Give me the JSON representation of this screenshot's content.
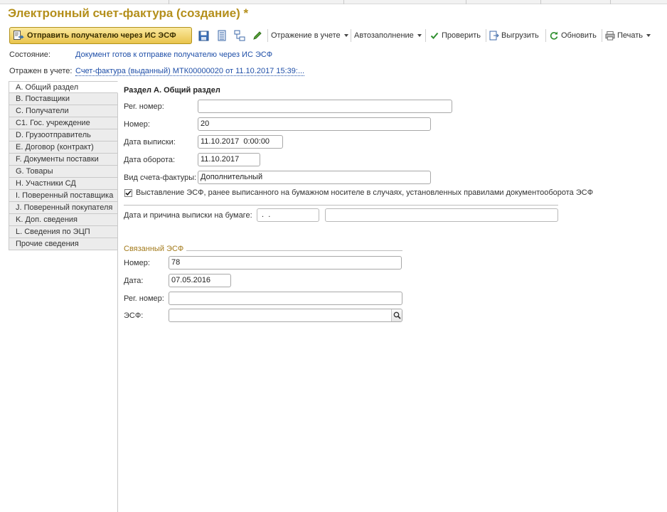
{
  "window": {
    "title": "Электронный счет-фактура (создание) *"
  },
  "toolbar": {
    "send_button": "Отправить получателю через ИС ЭСФ",
    "reflection": "Отражение в учете",
    "autofill": "Автозаполнение",
    "check": "Проверить",
    "export": "Выгрузить",
    "refresh": "Обновить",
    "print": "Печать"
  },
  "status": {
    "state_label": "Состояние:",
    "state_value": "Документ готов к отправке получателю через ИС ЭСФ",
    "reflected_label": "Отражен в учете:",
    "reflected_value": "Счет-фактура (выданный) МТК00000020 от 11.10.2017 15:39:..."
  },
  "tabs": [
    {
      "label": "А. Общий раздел"
    },
    {
      "label": "В. Поставщики"
    },
    {
      "label": "С. Получатели"
    },
    {
      "label": "С1. Гос. учреждение"
    },
    {
      "label": "D. Грузоотправитель"
    },
    {
      "label": "Е. Договор (контракт)"
    },
    {
      "label": "F. Документы поставки"
    },
    {
      "label": "G. Товары"
    },
    {
      "label": "Н. Участники СД"
    },
    {
      "label": "I. Поверенный поставщика"
    },
    {
      "label": "J. Поверенный покупателя"
    },
    {
      "label": "K. Доп. сведения"
    },
    {
      "label": "L. Сведения по ЭЦП"
    },
    {
      "label": "Прочие сведения"
    }
  ],
  "section_a": {
    "title": "Раздел А. Общий раздел",
    "reg_number_label": "Рег. номер:",
    "reg_number_value": "",
    "number_label": "Номер:",
    "number_value": "20",
    "issue_date_label": "Дата выписки:",
    "issue_date_value": "11.10.2017  0:00:00",
    "turnover_date_label": "Дата оборота:",
    "turnover_date_value": "11.10.2017",
    "invoice_type_label": "Вид счета-фактуры:",
    "invoice_type_value": "Дополнительный",
    "paper_issue_checkbox": "Выставление ЭСФ, ранее выписанного на бумажном носителе в случаях, установленных правилами документооборота ЭСФ",
    "paper_issue_checked": true,
    "paper_date_label": "Дата и причина выписки на бумаге:",
    "paper_date_value": " .  .",
    "paper_reason_value": ""
  },
  "related": {
    "title": "Связанный ЭСФ",
    "number_label": "Номер:",
    "number_value": "78",
    "date_label": "Дата:",
    "date_value": "07.05.2016",
    "reg_number_label": "Рег. номер:",
    "reg_number_value": "",
    "esf_label": "ЭСФ:",
    "esf_value": ""
  }
}
